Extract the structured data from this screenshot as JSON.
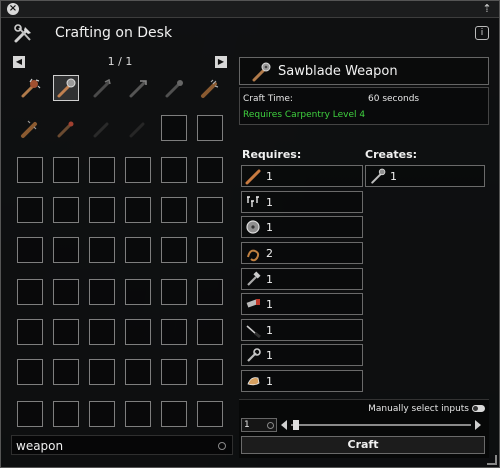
{
  "window": {
    "title": "Crafting on Desk",
    "close_icon": "close-icon",
    "pin_icon": "pin-icon",
    "info_icon": "info-icon"
  },
  "pager": {
    "text": "1 / 1"
  },
  "search": {
    "value": "weapon"
  },
  "recipe": {
    "name": "Sawblade Weapon",
    "craft_time_label": "Craft Time:",
    "craft_time_value": "60 seconds",
    "requirement": "Requires Carpentry Level 4"
  },
  "requires_label": "Requires:",
  "creates_label": "Creates:",
  "requires": [
    {
      "icon": "plank-icon",
      "qty": "1"
    },
    {
      "icon": "screws-icon",
      "qty": "1"
    },
    {
      "icon": "sawblade-icon",
      "qty": "1"
    },
    {
      "icon": "rope-icon",
      "qty": "2"
    },
    {
      "icon": "hammer-tool-icon",
      "qty": "1"
    },
    {
      "icon": "saw-tool-icon",
      "qty": "1"
    },
    {
      "icon": "screwdriver-tool-icon",
      "qty": "1"
    },
    {
      "icon": "wrench-tool-icon",
      "qty": "1"
    },
    {
      "icon": "glove-tool-icon",
      "qty": "1"
    }
  ],
  "creates": [
    {
      "icon": "sawblade-weapon-icon",
      "qty": "1"
    }
  ],
  "manual_select_label": "Manually select inputs",
  "quantity_value": "1",
  "craft_label": "Craft",
  "colors": {
    "requirement_text": "#3fd13f",
    "selected_slot": "#cfcfcf"
  }
}
